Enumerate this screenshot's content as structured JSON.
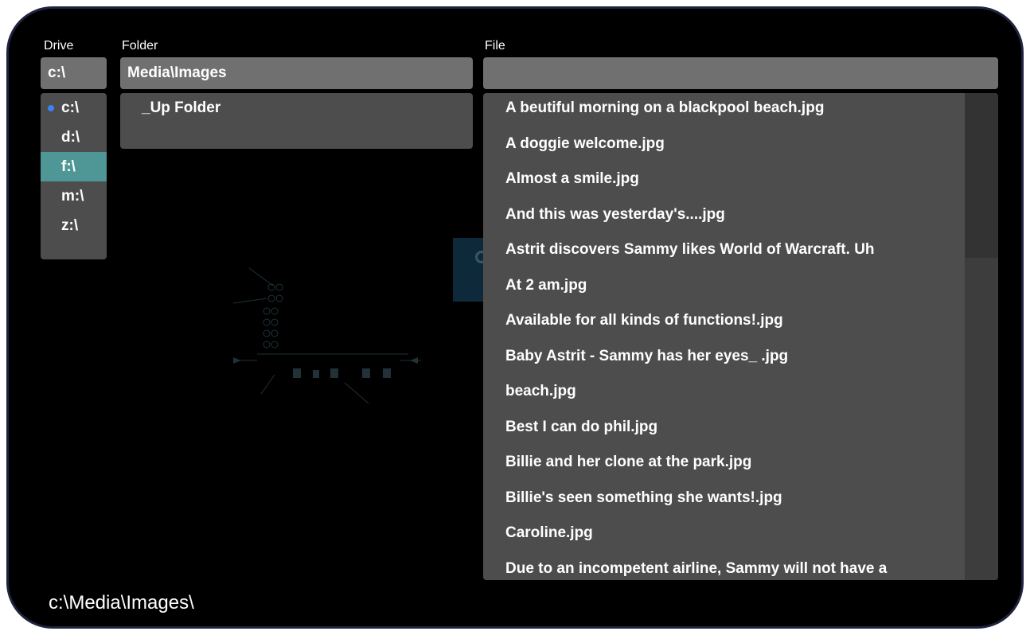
{
  "labels": {
    "drive": "Drive",
    "folder": "Folder",
    "file": "File"
  },
  "drive": {
    "current": "c:\\",
    "items": [
      {
        "label": "c:\\",
        "active_dot": true,
        "selected": false
      },
      {
        "label": "d:\\",
        "active_dot": false,
        "selected": false
      },
      {
        "label": "f:\\",
        "active_dot": false,
        "selected": true
      },
      {
        "label": "m:\\",
        "active_dot": false,
        "selected": false
      },
      {
        "label": "z:\\",
        "active_dot": false,
        "selected": false
      }
    ]
  },
  "folder": {
    "current": "Media\\Images",
    "items": [
      {
        "label": "_Up Folder"
      }
    ]
  },
  "file": {
    "current": "",
    "items": [
      {
        "label": "A beutiful morning on a blackpool beach.jpg"
      },
      {
        "label": "A doggie welcome.jpg"
      },
      {
        "label": "Almost a smile.jpg"
      },
      {
        "label": "And this was yesterday's....jpg"
      },
      {
        "label": "Astrit discovers Sammy likes World of Warcraft. Uh"
      },
      {
        "label": "At 2 am.jpg"
      },
      {
        "label": "Available for all kinds of functions!.jpg"
      },
      {
        "label": "Baby Astrit - Sammy has her eyes_ .jpg"
      },
      {
        "label": "beach.jpg"
      },
      {
        "label": "Best I can do phil.jpg"
      },
      {
        "label": "Billie and her clone at the park.jpg"
      },
      {
        "label": "Billie's seen something she wants!.jpg"
      },
      {
        "label": "Caroline.jpg"
      },
      {
        "label": "Due to an incompetent airline, Sammy will not have a"
      }
    ]
  },
  "path": "c:\\Media\\Images\\",
  "colors": {
    "background": "#000000",
    "field": "#707070",
    "panel": "#4d4d4d",
    "selected": "#4f9796",
    "active_dot": "#3b82f6",
    "frame": "#20233f"
  },
  "background_diagram": {
    "icons": [
      "media-file-icon",
      "projection-icon",
      "play-icon",
      "progress-bar-icon",
      "save-icon",
      "load-icon"
    ]
  }
}
